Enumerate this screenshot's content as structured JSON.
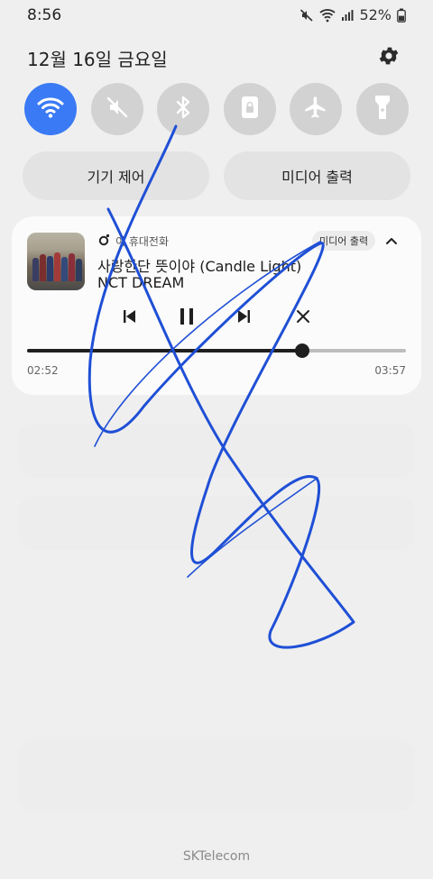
{
  "status_bar": {
    "time": "8:56",
    "battery": "52%",
    "icons": [
      "mute-icon",
      "wifi-icon",
      "signal-icon",
      "battery-icon"
    ]
  },
  "header": {
    "date": "12월 16일 금요일",
    "settings_icon": "gear-icon"
  },
  "quick_settings": [
    {
      "name": "wifi",
      "icon": "wifi-icon",
      "active": true
    },
    {
      "name": "sound",
      "icon": "mute-icon",
      "active": false
    },
    {
      "name": "bluetooth",
      "icon": "bluetooth-icon",
      "active": false
    },
    {
      "name": "screen-lock",
      "icon": "lock-icon",
      "active": false
    },
    {
      "name": "airplane",
      "icon": "airplane-icon",
      "active": false
    },
    {
      "name": "flashlight",
      "icon": "flashlight-icon",
      "active": false
    }
  ],
  "pills": {
    "device_control": "기기 제어",
    "media_output": "미디어 출력"
  },
  "media": {
    "source": "이 휴대전화",
    "output_chip": "미디어 출력",
    "title": "사랑한단 뜻이야 (Candle Light)",
    "artist": "NCT DREAM",
    "elapsed": "02:52",
    "total": "03:57",
    "progress": 0.727,
    "controls": [
      "previous-icon",
      "pause-icon",
      "next-icon",
      "close-icon"
    ]
  },
  "carrier": "SKTelecom",
  "colors": {
    "accent": "#3a7af4",
    "scribble": "#1f4fd6",
    "background": "#efefef"
  }
}
